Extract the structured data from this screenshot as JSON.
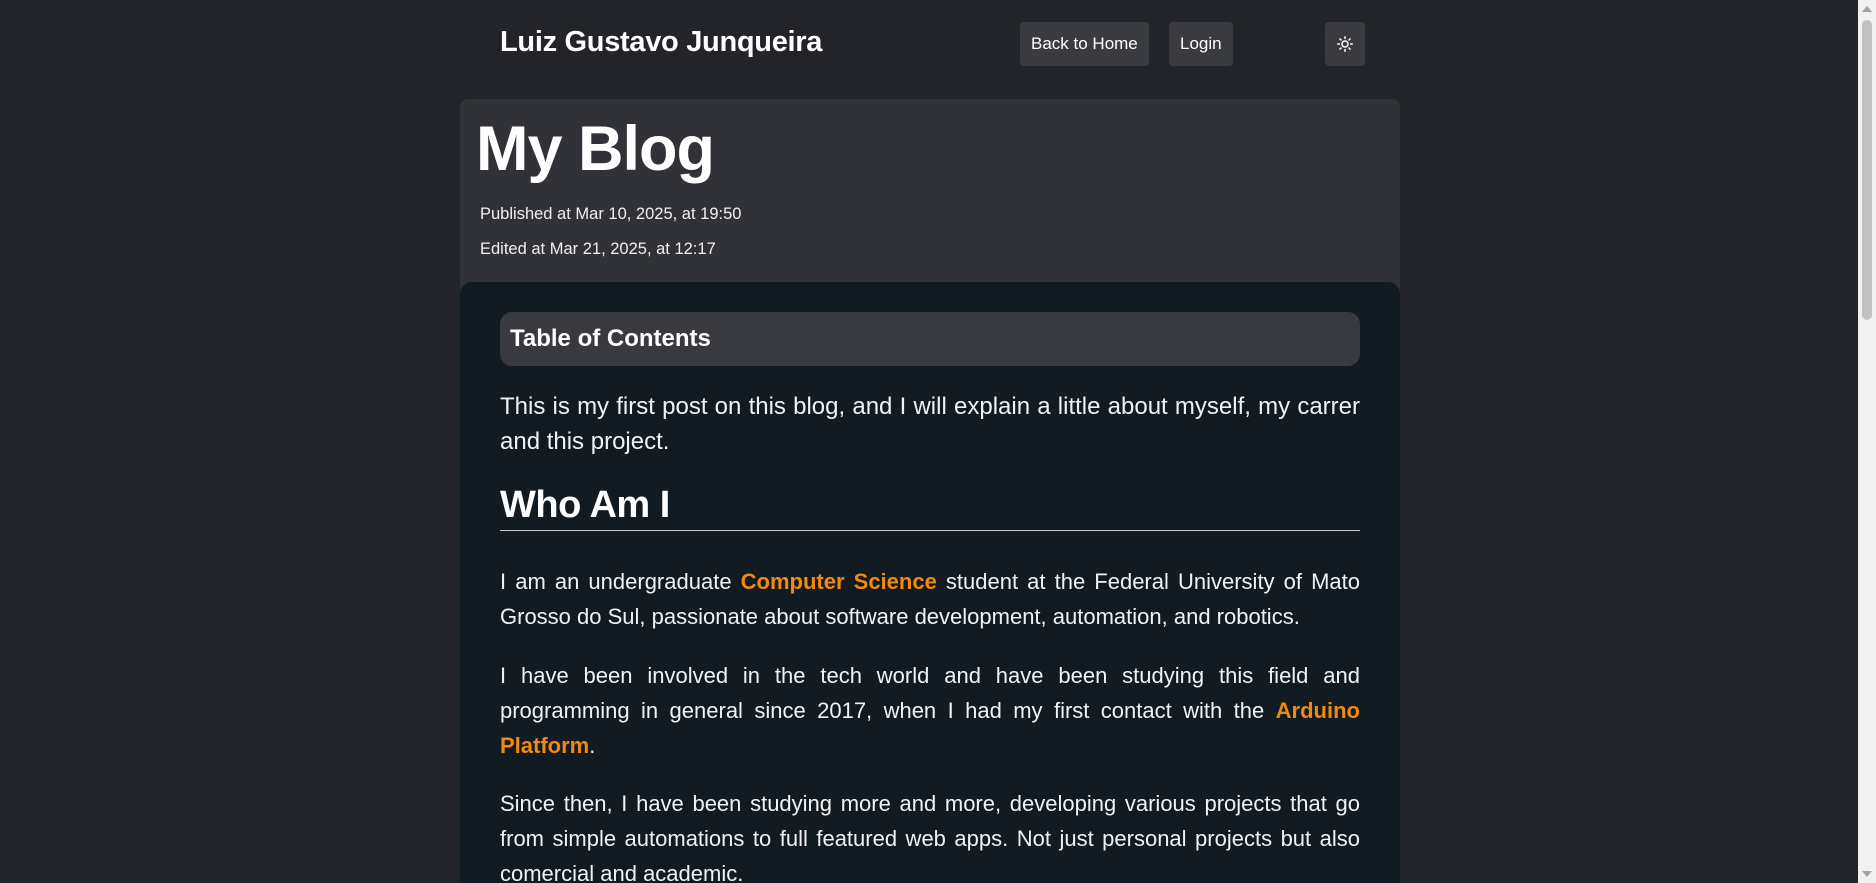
{
  "header": {
    "site_title": "Luiz Gustavo Junqueira",
    "nav": {
      "home_label": "Back to Home",
      "login_label": "Login"
    },
    "theme_toggle_icon": "sun-icon"
  },
  "post": {
    "title": "My Blog",
    "published": "Published at Mar 10, 2025, at 19:50",
    "edited": "Edited at Mar 21, 2025, at 12:17",
    "toc_title": "Table of Contents",
    "intro": "This is my first post on this blog, and I will explain a little about myself, my carrer and this project.",
    "section_title": "Who Am I",
    "p1": {
      "before": "I am an undergraduate ",
      "link": "Computer Science",
      "after": " student at the Federal University of Mato Grosso do Sul, passionate about software development, automation, and robotics."
    },
    "p2": {
      "before": "I have been involved in the tech world and have been studying this field and programming in general since 2017, when I had my first contact with the ",
      "link": "Arduino Platform",
      "after": "."
    },
    "p3": "Since then, I have been studying more and more, developing various projects that go from simple automations to full featured web apps. Not just personal projects but also comercial and academic."
  },
  "colors": {
    "page_background": "#222429",
    "title_card": "#313237",
    "content_card": "#121b22",
    "button": "#3a3b40",
    "accent_link": "#f08a0c"
  }
}
